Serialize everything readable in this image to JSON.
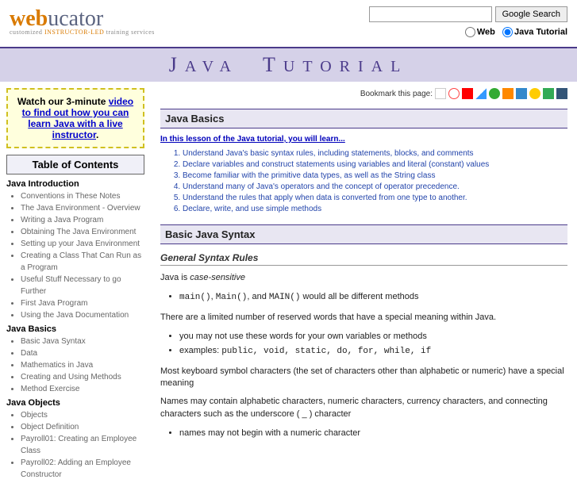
{
  "header": {
    "logo_web": "web",
    "logo_ucator": "ucator",
    "tagline_1": "customized ",
    "tagline_2": "INSTRUCTOR-LED",
    "tagline_3": " training services",
    "search_button": "Google Search",
    "radio_web": "Web",
    "radio_tutorial": "Java Tutorial"
  },
  "title": {
    "j": "J",
    "ava": "AVA",
    "t": "T",
    "utorial": "UTORIAL"
  },
  "promo": {
    "pre": "Watch our 3-minute ",
    "link": "video to find out how you can learn Java with a live instructor",
    "post": "."
  },
  "toc": {
    "header": "Table of Contents",
    "sections": [
      {
        "title": "Java Introduction",
        "items": [
          "Conventions in These Notes",
          "The Java Environment - Overview",
          "Writing a Java Program",
          "Obtaining The Java Environment",
          "Setting up your Java Environment",
          "Creating a Class That Can Run as a Program",
          "Useful Stuff Necessary to go Further",
          "First Java Program",
          "Using the Java Documentation"
        ]
      },
      {
        "title": "Java Basics",
        "items": [
          "Basic Java Syntax",
          "Data",
          "Mathematics in Java",
          "Creating and Using Methods",
          "Method Exercise"
        ]
      },
      {
        "title": "Java Objects",
        "items": [
          "Objects",
          "Object Definition",
          "Payroll01: Creating an Employee Class",
          "Payroll02: Adding an Employee Constructor"
        ]
      }
    ]
  },
  "bookmark_label": "Bookmark this page:",
  "content": {
    "h1": "Java Basics",
    "lesson_intro": "In this lesson of the Java tutorial, you will learn...",
    "objectives": [
      "Understand Java's basic syntax rules, including statements, blocks, and comments",
      "Declare variables and construct statements using variables and literal (constant) values",
      "Become familiar with the primitive data types, as well as the String class",
      "Understand many of Java's operators and the concept of operator precedence.",
      "Understand the rules that apply when data is converted from one type to another.",
      "Declare, write, and use simple methods"
    ],
    "h2": "Basic Java Syntax",
    "sub_h": "General Syntax Rules",
    "p1_pre": "Java is ",
    "p1_em": "case-sensitive",
    "bullet1_a": "main()",
    "bullet1_b": "Main()",
    "bullet1_c": "MAIN()",
    "bullet1_rest": " would all be different methods",
    "p2": "There are a limited number of reserved words that have a special meaning within Java.",
    "bullet2": "you may not use these words for your own variables or methods",
    "bullet3_pre": "examples: ",
    "bullet3_code": "public, void, static, do, for, while, if",
    "p3": "Most keyboard symbol characters (the set of characters other than alphabetic or numeric) have a special meaning",
    "p4": "Names may contain alphabetic characters, numeric characters, currency characters, and connecting characters such as the underscore ( _ ) character",
    "bullet4": "names may not begin with a numeric character"
  }
}
